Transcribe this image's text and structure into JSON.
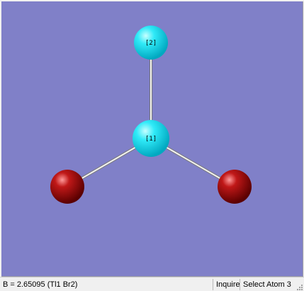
{
  "viewer": {
    "background_color": "#8080c8",
    "bond_color": "#e8e8e8",
    "atoms": [
      {
        "label": "[2]",
        "element": "Tl",
        "color": "#00e0f0"
      },
      {
        "label": "[1]",
        "element": "Tl",
        "color": "#00e0f0"
      },
      {
        "label": "",
        "element": "Br",
        "color": "#b01010"
      },
      {
        "label": "",
        "element": "Br",
        "color": "#b01010"
      }
    ]
  },
  "statusbar": {
    "measurement": "B = 2.65095 (Tl1 Br2)",
    "mode": "Inquire",
    "action": "Select Atom 3"
  },
  "icons": {
    "size_grip": "size-grip-icon"
  }
}
